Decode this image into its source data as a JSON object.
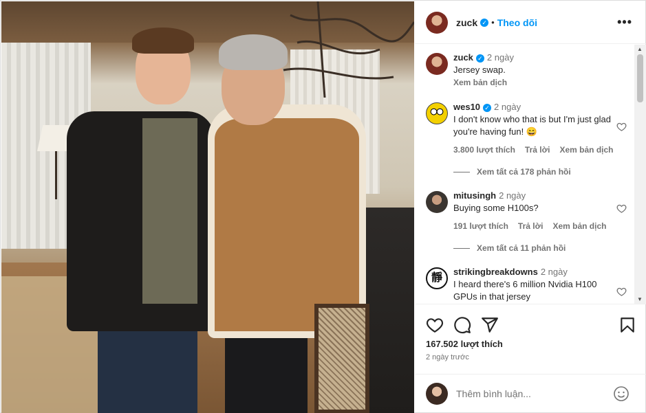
{
  "post": {
    "author": "zuck",
    "follow_label": "Theo dõi",
    "more_label": "•••"
  },
  "caption": {
    "username": "zuck",
    "time": "2 ngày",
    "text": "Jersey swap.",
    "translate": "Xem bản dịch"
  },
  "comments": [
    {
      "username": "wes10",
      "verified": true,
      "time": "2 ngày",
      "text": "I don't know who that is but I'm just glad you're having fun! 😄",
      "likes": "3.800 lượt thích",
      "reply": "Trả lời",
      "translate": "Xem bản dịch",
      "replies": "Xem tất cả 178 phản hồi"
    },
    {
      "username": "mitusingh",
      "verified": false,
      "time": "2 ngày",
      "text": "Buying some H100s?",
      "likes": "191 lượt thích",
      "reply": "Trả lời",
      "translate": "Xem bản dịch",
      "replies": "Xem tất cả 11 phản hồi"
    },
    {
      "username": "strikingbreakdowns",
      "verified": false,
      "time": "2 ngày",
      "text": "I heard there's 6 million Nvidia H100 GPUs in that jersey",
      "avatar_glyph": "靜"
    }
  ],
  "actions": {
    "like_count": "167.502 lượt thích",
    "posted_ago": "2 ngày trước"
  },
  "comment_input": {
    "placeholder": "Thêm bình luận..."
  },
  "icons": [
    "heart-icon",
    "comment-icon",
    "share-icon",
    "bookmark-icon",
    "emoji-icon",
    "verified-icon",
    "more-icon"
  ],
  "colors": {
    "accent": "#0095f6",
    "muted": "#737373",
    "text": "#262626"
  }
}
